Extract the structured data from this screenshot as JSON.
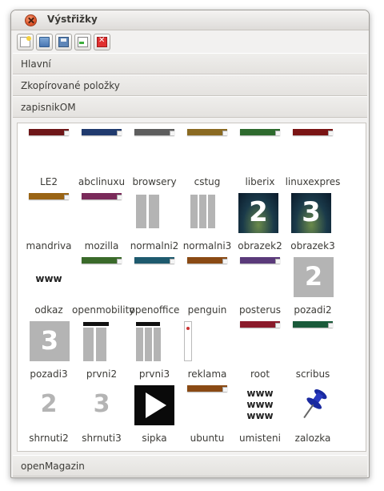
{
  "window": {
    "title": "Výstřižky"
  },
  "toolbar": {
    "buttons": [
      "new-icon",
      "open-icon",
      "save-icon",
      "copy-icon",
      "delete-icon"
    ]
  },
  "sections": {
    "s1": "Hlavní",
    "s2": "Zkopírované položky",
    "s3": "zapisnikOM",
    "s4": "openMagazin"
  },
  "clips": [
    {
      "label": "LE2",
      "kind": "banner",
      "color": "#6e1618"
    },
    {
      "label": "abclinuxu",
      "kind": "banner",
      "color": "#203a6e"
    },
    {
      "label": "browsery",
      "kind": "banner",
      "color": "#5e5e5e"
    },
    {
      "label": "cstug",
      "kind": "banner",
      "color": "#8a6a22"
    },
    {
      "label": "liberix",
      "kind": "banner",
      "color": "#2e6a2e"
    },
    {
      "label": "linuxexpres",
      "kind": "banner",
      "color": "#7a1414"
    },
    {
      "label": "mandriva",
      "kind": "banner",
      "color": "#9a6414"
    },
    {
      "label": "mozilla",
      "kind": "banner",
      "color": "#7a2a5a"
    },
    {
      "label": "normalni2",
      "kind": "cols2"
    },
    {
      "label": "normalni3",
      "kind": "cols3"
    },
    {
      "label": "obrazek2",
      "kind": "photo",
      "digit": "2"
    },
    {
      "label": "obrazek3",
      "kind": "photo",
      "digit": "3"
    },
    {
      "label": "odkaz",
      "kind": "www",
      "text": "www"
    },
    {
      "label": "openmobility",
      "kind": "banner",
      "color": "#3a6a2a"
    },
    {
      "label": "openoffice",
      "kind": "banner",
      "color": "#1e5a6e"
    },
    {
      "label": "penguin",
      "kind": "banner",
      "color": "#8a4a14"
    },
    {
      "label": "posterus",
      "kind": "banner",
      "color": "#5a3a7a"
    },
    {
      "label": "pozadi2",
      "kind": "graybox",
      "digit": "2"
    },
    {
      "label": "pozadi3",
      "kind": "graybox",
      "digit": "3"
    },
    {
      "label": "prvni2",
      "kind": "cols2bar"
    },
    {
      "label": "prvni3",
      "kind": "cols3bar"
    },
    {
      "label": "reklama",
      "kind": "reklama"
    },
    {
      "label": "root",
      "kind": "banner",
      "color": "#8a1a2a"
    },
    {
      "label": "scribus",
      "kind": "banner",
      "color": "#1a5a3a"
    },
    {
      "label": "shrnuti2",
      "kind": "graydigit",
      "digit": "2"
    },
    {
      "label": "shrnuti3",
      "kind": "graydigit",
      "digit": "3"
    },
    {
      "label": "sipka",
      "kind": "play"
    },
    {
      "label": "ubuntu",
      "kind": "banner",
      "color": "#8a4a14"
    },
    {
      "label": "umisteni",
      "kind": "www3",
      "text": "www"
    },
    {
      "label": "zalozka",
      "kind": "pin"
    }
  ]
}
